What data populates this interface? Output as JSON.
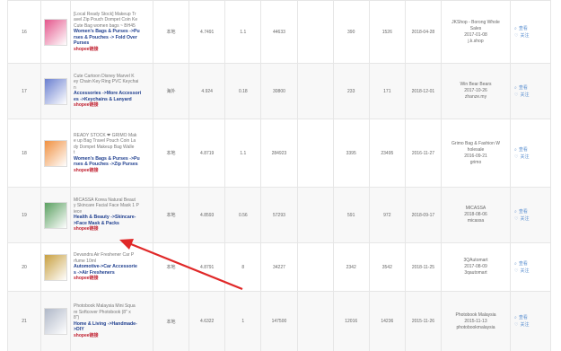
{
  "rows": [
    {
      "num": "16",
      "title": [
        "[Local Ready Stock] Makeup Tr",
        "avel Zip Pouch Dompet Coin Ke",
        "Cute Bag women bags ~ BH45"
      ],
      "category": [
        "Women's Bags & Purses ->Pu",
        "rses & Pouches -> Fold Over",
        "Purses"
      ],
      "shopee": "shopee",
      "origin": "本地",
      "price": "4.7491",
      "rating": "1.1",
      "sold": "44633",
      "v1": "390",
      "v2": "1526",
      "date": "2018-04-28",
      "seller": [
        "JKShop - Borong Whole",
        "Sales",
        "2017-01-08",
        "j.k.shop"
      ],
      "actions": [
        "查看",
        "关注"
      ],
      "thumb_color": "#e4568c"
    },
    {
      "num": "17",
      "title": [
        "Cute Cartoon Disney Marvel K",
        "ey Chain Key Ring PVC Keychai",
        "n"
      ],
      "category": [
        "Accessories ->More Accessori",
        "es ->Keychains & Lanyard"
      ],
      "shopee": "shopee",
      "origin": "海外",
      "price": "4.924",
      "rating": "0.18",
      "sold": "30800",
      "v1": "233",
      "v2": "171",
      "date": "2018-12-01",
      "seller": [
        "Win Bear Bears",
        "2017-10-26",
        "zhanze.my"
      ],
      "actions": [
        "查看",
        "关注"
      ],
      "thumb_color": "#6a7fd0"
    },
    {
      "num": "18",
      "title": [
        "READY STOCK ❤ GRIMO Mak",
        "e up Bag Travel Pouch Coin La",
        "dy Dompet Makeup Bag Walle",
        "t"
      ],
      "category": [
        "Women's Bags & Purses ->Pu",
        "rses & Pouches ->Zip Purses"
      ],
      "shopee": "shopee",
      "origin": "本地",
      "price": "4.8719",
      "rating": "1.1",
      "sold": "284923",
      "v1": "3395",
      "v2": "23495",
      "date": "2016-11-27",
      "seller": [
        "Grimo Bag & Fashion W",
        "holesale",
        "2016-09-21",
        "grimo"
      ],
      "actions": [
        "查看",
        "关注"
      ],
      "thumb_color": "#f09040"
    },
    {
      "num": "19",
      "title": [
        "MICASSA Korea Natural Beaut",
        "y Skincare Facial Face Mask 1 P",
        "iece"
      ],
      "category": [
        "Health & Beauty ->Skincare-",
        ">Face Mask & Packs"
      ],
      "shopee": "shopee",
      "origin": "本地",
      "price": "4.8593",
      "rating": "0.56",
      "sold": "57293",
      "v1": "591",
      "v2": "972",
      "date": "2018-09-17",
      "seller": [
        "MICASSA",
        "2018-08-06",
        "micassa"
      ],
      "actions": [
        "查看",
        "关注"
      ],
      "thumb_color": "#5aa060"
    },
    {
      "num": "20",
      "title": [
        "Devandra Air Freshener Car P",
        "rfume 10ml"
      ],
      "category": [
        "Automotive->Car Accessorie",
        "s ->Air Fresheners"
      ],
      "shopee": "shopee",
      "origin": "本地",
      "price": "4.8791",
      "rating": "8",
      "sold": "34227",
      "v1": "2342",
      "v2": "3542",
      "date": "2018-11-25",
      "seller": [
        "3QAutomart",
        "2017-08-09",
        "3qautomart"
      ],
      "actions": [
        "查看",
        "关注"
      ],
      "thumb_color": "#c8a040"
    },
    {
      "num": "21",
      "title": [
        "Photobook Malaysia Mini Squa",
        "re Softcover Photobook (8\" x",
        "8\")"
      ],
      "category": [
        "Home & Living ->Handmade-",
        ">DIY"
      ],
      "shopee": "shopee",
      "origin": "本地",
      "price": "4.6322",
      "rating": "1",
      "sold": "147500",
      "v1": "12016",
      "v2": "14236",
      "date": "2015-11-26",
      "seller": [
        "Photobook Malaysia",
        "2015-11-13",
        "photobookmalaysia"
      ],
      "actions": [
        "查看",
        "关注"
      ],
      "thumb_color": "#b0b8c8"
    }
  ],
  "shopee_suffix": "链接",
  "colors": {
    "arrow": "#e02828",
    "category": "#1f3f8f",
    "shopee": "#c02030",
    "action": "#5a8fd0"
  },
  "icons": {
    "action_view": "search-icon",
    "action_follow": "heart-icon"
  }
}
